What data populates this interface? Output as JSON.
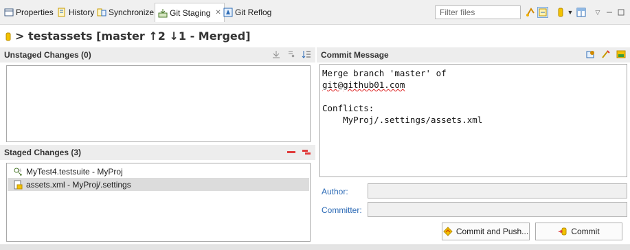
{
  "tabs": [
    {
      "label": "Properties",
      "icon": "properties-icon",
      "active": false
    },
    {
      "label": "History",
      "icon": "history-icon",
      "active": false
    },
    {
      "label": "Synchronize",
      "icon": "synchronize-icon",
      "active": false
    },
    {
      "label": "Git Staging",
      "icon": "git-staging-icon",
      "active": true,
      "close": "✕"
    },
    {
      "label": "Git Reflog",
      "icon": "git-reflog-icon",
      "active": false
    }
  ],
  "toolbar": {
    "filter_placeholder": "Filter files"
  },
  "repo": {
    "title": "> testassets [master ↑2 ↓1 - Merged]"
  },
  "unstaged": {
    "header": "Unstaged Changes (0)"
  },
  "staged": {
    "header": "Staged Changes (3)",
    "items": [
      {
        "label": "MyTest4.testsuite - MyProj",
        "selected": false
      },
      {
        "label": "assets.xml - MyProj/.settings",
        "selected": true
      }
    ]
  },
  "commit": {
    "header": "Commit Message",
    "lines": [
      "Merge branch 'master' of",
      "git@github01.com",
      "",
      "Conflicts:",
      "    MyProj/.settings/assets.xml"
    ],
    "author_label": "Author:",
    "committer_label": "Committer:",
    "commit_and_push_label": "Commit and Push...",
    "commit_label": "Commit"
  },
  "colors": {
    "accent_blue": "#2d6bb6",
    "red_tool": "#e03b3b",
    "repo_icon": "#f0b000"
  }
}
